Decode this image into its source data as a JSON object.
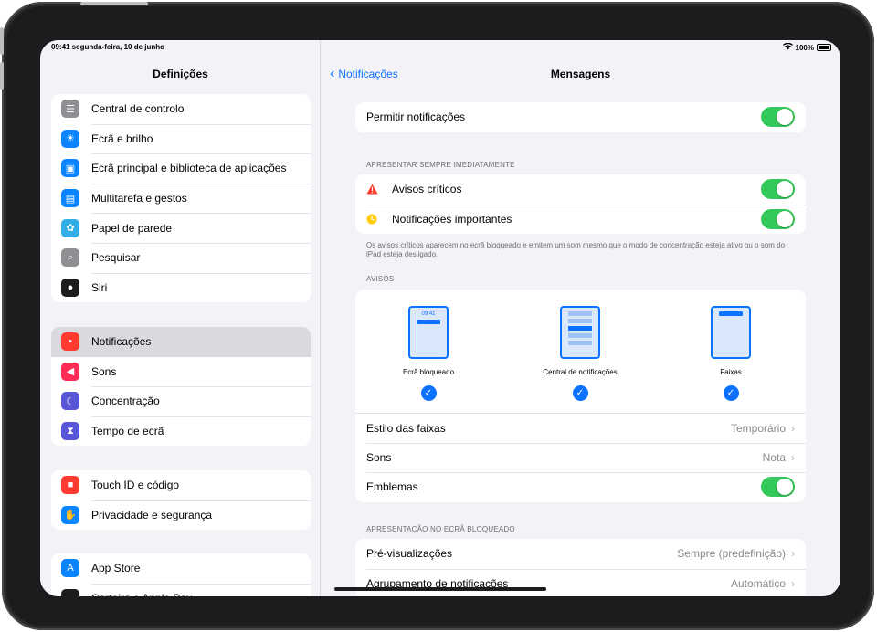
{
  "status": {
    "time_date": "09:41 segunda-feira, 10 de junho",
    "battery": "100%"
  },
  "sidebar": {
    "title": "Definições",
    "groups": [
      {
        "items": [
          {
            "label": "Central de controlo",
            "icon": "control-center-icon",
            "color": "#8e8e93"
          },
          {
            "label": "Ecrã e brilho",
            "icon": "brightness-icon",
            "color": "#0a84ff"
          },
          {
            "label": "Ecrã principal e biblioteca de aplicações",
            "icon": "home-screen-icon",
            "color": "#0a84ff"
          },
          {
            "label": "Multitarefa e gestos",
            "icon": "multitasking-icon",
            "color": "#0a84ff"
          },
          {
            "label": "Papel de parede",
            "icon": "wallpaper-icon",
            "color": "#32ade6"
          },
          {
            "label": "Pesquisar",
            "icon": "search-icon",
            "color": "#8e8e93"
          },
          {
            "label": "Siri",
            "icon": "siri-icon",
            "color": "#1c1c1e"
          }
        ]
      },
      {
        "items": [
          {
            "label": "Notificações",
            "icon": "notifications-icon",
            "color": "#ff3b30",
            "active": true
          },
          {
            "label": "Sons",
            "icon": "sounds-icon",
            "color": "#ff2d55"
          },
          {
            "label": "Concentração",
            "icon": "focus-moon-icon",
            "color": "#5856d6"
          },
          {
            "label": "Tempo de ecrã",
            "icon": "screen-time-icon",
            "color": "#5856d6"
          }
        ]
      },
      {
        "items": [
          {
            "label": "Touch ID e código",
            "icon": "lock-icon",
            "color": "#ff3b30"
          },
          {
            "label": "Privacidade e segurança",
            "icon": "hand-icon",
            "color": "#0a84ff"
          }
        ]
      },
      {
        "items": [
          {
            "label": "App Store",
            "icon": "app-store-icon",
            "color": "#0a84ff"
          },
          {
            "label": "Carteira e Apple Pay",
            "icon": "wallet-icon",
            "color": "#1c1c1e"
          }
        ]
      }
    ]
  },
  "detail": {
    "back_label": "Notificações",
    "title": "Mensagens",
    "allow_label": "Permitir notificações",
    "section_immediate": "APRESENTAR SEMPRE IMEDIATAMENTE",
    "critical_label": "Avisos críticos",
    "important_label": "Notificações importantes",
    "immediate_footnote": "Os avisos críticos aparecem no ecrã bloqueado e emitem um som mesmo que o modo de concentração esteja ativo ou o som do iPad esteja desligado.",
    "section_alerts": "AVISOS",
    "alert_options": [
      {
        "label": "Ecrã bloqueado",
        "time": "09:41",
        "checked": true
      },
      {
        "label": "Central de notificações",
        "checked": true
      },
      {
        "label": "Faixas",
        "checked": true
      }
    ],
    "banner_style_label": "Estilo das faixas",
    "banner_style_value": "Temporário",
    "sounds_label": "Sons",
    "sounds_value": "Nota",
    "badges_label": "Emblemas",
    "section_lock": "APRESENTAÇÃO NO ECRÃ BLOQUEADO",
    "previews_label": "Pré-visualizações",
    "previews_value": "Sempre (predefinição)",
    "grouping_label": "Agrupamento de notificações",
    "grouping_value": "Automático"
  }
}
